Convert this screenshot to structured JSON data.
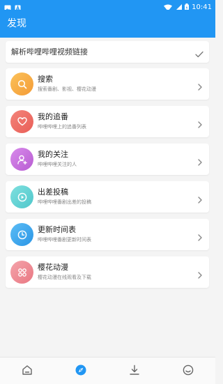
{
  "status_bar": {
    "time": "10:41"
  },
  "app_bar": {
    "title": "发现"
  },
  "parse_link": {
    "label": "解析哔哩哔哩视频链接"
  },
  "items": [
    {
      "title": "搜索",
      "subtitle": "搜索番剧、影视、樱花动漫",
      "icon": "search-icon",
      "color": "#f7a541"
    },
    {
      "title": "我的追番",
      "subtitle": "哔哩哔哩上的追番列表",
      "icon": "heart-icon",
      "color": "#ee6d63"
    },
    {
      "title": "我的关注",
      "subtitle": "哔哩哔哩关注的人",
      "icon": "user-follow-icon",
      "color": "#c46fdc"
    },
    {
      "title": "出差投稿",
      "subtitle": "哔哩哔哩番剧出差的投稿",
      "icon": "play-icon",
      "color": "#5fd1d2"
    },
    {
      "title": "更新时间表",
      "subtitle": "哔哩哔哩番剧更新时间表",
      "icon": "clock-icon",
      "color": "#3aa8ee"
    },
    {
      "title": "樱花动漫",
      "subtitle": "樱花动漫在线观看及下载",
      "icon": "grid-icon",
      "color": "#ef8c96"
    }
  ],
  "bottom_nav": {
    "items": [
      {
        "icon": "home-icon"
      },
      {
        "icon": "compass-icon",
        "active": true
      },
      {
        "icon": "download-icon"
      },
      {
        "icon": "smile-icon"
      }
    ],
    "active_color": "#2196f3",
    "inactive_color": "#666666"
  }
}
